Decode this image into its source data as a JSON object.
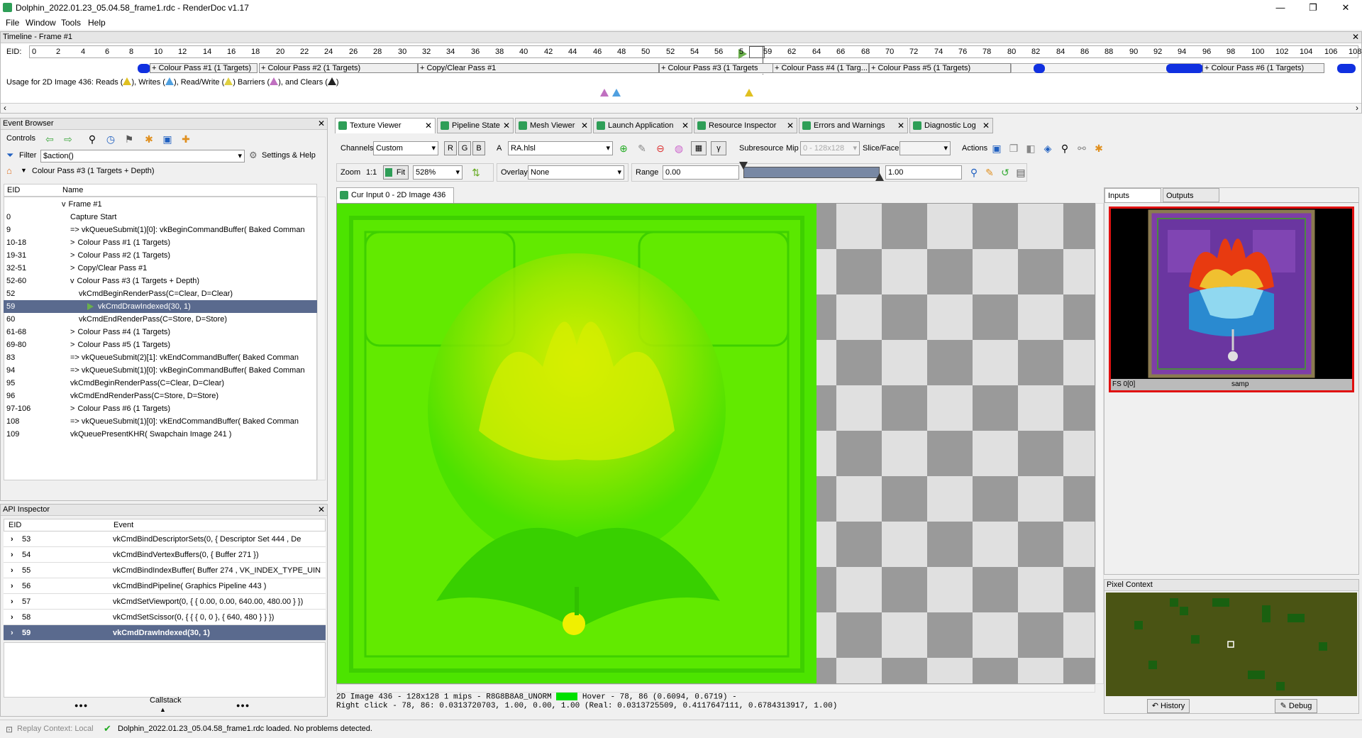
{
  "window": {
    "title": "Dolphin_2022.01.23_05.04.58_frame1.rdc - RenderDoc v1.17",
    "controls": [
      "—",
      "❐",
      "✕"
    ]
  },
  "menu": [
    "File",
    "Window",
    "Tools",
    "Help"
  ],
  "timeline": {
    "title": "Timeline - Frame #1",
    "eid_label": "EID:",
    "ticks": [
      "0",
      "2",
      "4",
      "6",
      "8",
      "10",
      "12",
      "14",
      "16",
      "18",
      "20",
      "22",
      "24",
      "26",
      "28",
      "30",
      "32",
      "34",
      "36",
      "38",
      "40",
      "42",
      "44",
      "46",
      "48",
      "50",
      "52",
      "54",
      "56",
      "5",
      "59",
      "62",
      "64",
      "66",
      "68",
      "70",
      "72",
      "74",
      "76",
      "78",
      "80",
      "82",
      "84",
      "86",
      "88",
      "90",
      "92",
      "94",
      "96",
      "98",
      "100",
      "102",
      "104",
      "106",
      "108"
    ],
    "passes": [
      "+ Colour Pass #1 (1 Targets)",
      "+ Colour Pass #2 (1 Targets)",
      "+ Copy/Clear Pass #1",
      "+ Colour Pass #3 (1 Targets",
      "+ Colour Pass #4 (1 Targ...",
      "+ Colour Pass #5 (1 Targets)",
      "+ Colour Pass #6 (1 Targets)"
    ],
    "usage_text_1": "Usage for 2D Image 436: Reads (",
    "usage_text_2": "), Writes (",
    "usage_text_3": "), Read/Write (",
    "usage_text_4": ") Barriers (",
    "usage_text_5": "), and Clears (",
    "usage_text_6": ")"
  },
  "event_browser": {
    "title": "Event Browser",
    "controls_label": "Controls",
    "filter_label": "Filter",
    "filter_value": "$action()",
    "settings_label": "Settings & Help",
    "breadcrumb": "Colour Pass #3 (1 Targets + Depth)",
    "col_eid": "EID",
    "col_name": "Name",
    "rows": [
      {
        "eid": "",
        "name": "Frame #1",
        "indent": 0,
        "exp": "v"
      },
      {
        "eid": "0",
        "name": "Capture Start",
        "indent": 1,
        "exp": ""
      },
      {
        "eid": "9",
        "name": "=> vkQueueSubmit(1)[0]: vkBeginCommandBuffer( Baked Comman",
        "indent": 1,
        "exp": ""
      },
      {
        "eid": "10-18",
        "name": "Colour Pass #1 (1 Targets)",
        "indent": 1,
        "exp": ">"
      },
      {
        "eid": "19-31",
        "name": "Colour Pass #2 (1 Targets)",
        "indent": 1,
        "exp": ">"
      },
      {
        "eid": "32-51",
        "name": "Copy/Clear Pass #1",
        "indent": 1,
        "exp": ">"
      },
      {
        "eid": "52-60",
        "name": "Colour Pass #3 (1 Targets + Depth)",
        "indent": 1,
        "exp": "v"
      },
      {
        "eid": "52",
        "name": "vkCmdBeginRenderPass(C=Clear, D=Clear)",
        "indent": 2,
        "exp": ""
      },
      {
        "eid": "59",
        "name": "vkCmdDrawIndexed(30, 1)",
        "indent": 3,
        "exp": "",
        "selected": true
      },
      {
        "eid": "60",
        "name": "vkCmdEndRenderPass(C=Store, D=Store)",
        "indent": 2,
        "exp": ""
      },
      {
        "eid": "61-68",
        "name": "Colour Pass #4 (1 Targets)",
        "indent": 1,
        "exp": ">"
      },
      {
        "eid": "69-80",
        "name": "Colour Pass #5 (1 Targets)",
        "indent": 1,
        "exp": ">"
      },
      {
        "eid": "83",
        "name": "=> vkQueueSubmit(2)[1]: vkEndCommandBuffer( Baked Comman",
        "indent": 1,
        "exp": ""
      },
      {
        "eid": "94",
        "name": "=> vkQueueSubmit(1)[0]: vkBeginCommandBuffer( Baked Comman",
        "indent": 1,
        "exp": ""
      },
      {
        "eid": "95",
        "name": "vkCmdBeginRenderPass(C=Clear, D=Clear)",
        "indent": 1,
        "exp": ""
      },
      {
        "eid": "96",
        "name": "vkCmdEndRenderPass(C=Store, D=Store)",
        "indent": 1,
        "exp": ""
      },
      {
        "eid": "97-106",
        "name": "Colour Pass #6 (1 Targets)",
        "indent": 1,
        "exp": ">"
      },
      {
        "eid": "108",
        "name": "=> vkQueueSubmit(1)[0]: vkEndCommandBuffer( Baked Comman",
        "indent": 1,
        "exp": ""
      },
      {
        "eid": "109",
        "name": "vkQueuePresentKHR( Swapchain Image 241 )",
        "indent": 1,
        "exp": ""
      }
    ]
  },
  "api_inspector": {
    "title": "API Inspector",
    "col_eid": "EID",
    "col_event": "Event",
    "rows": [
      {
        "eid": "53",
        "event": "vkCmdBindDescriptorSets(0, { Descriptor Set 444 , De"
      },
      {
        "eid": "54",
        "event": "vkCmdBindVertexBuffers(0, { Buffer 271 })"
      },
      {
        "eid": "55",
        "event": "vkCmdBindIndexBuffer( Buffer 274 , VK_INDEX_TYPE_UIN"
      },
      {
        "eid": "56",
        "event": "vkCmdBindPipeline( Graphics Pipeline 443 )"
      },
      {
        "eid": "57",
        "event": "vkCmdSetViewport(0, { { 0.00, 0.00, 640.00, 480.00 } })"
      },
      {
        "eid": "58",
        "event": "vkCmdSetScissor(0, { { { 0, 0 }, { 640, 480 } } })"
      },
      {
        "eid": "59",
        "event": "vkCmdDrawIndexed(30, 1)",
        "selected": true
      }
    ],
    "callstack_label": "Callstack",
    "dots": "●●●"
  },
  "tabs": [
    {
      "label": "Texture Viewer",
      "active": true
    },
    {
      "label": "Pipeline State"
    },
    {
      "label": "Mesh Viewer"
    },
    {
      "label": "Launch Application"
    },
    {
      "label": "Resource Inspector"
    },
    {
      "label": "Errors and Warnings"
    },
    {
      "label": "Diagnostic Log"
    }
  ],
  "texture_viewer": {
    "channels_label": "Channels",
    "channels_value": "Custom",
    "r": "R",
    "g": "G",
    "b": "B",
    "a": "A",
    "shader_value": "RA.hlsl",
    "gamma": "γ",
    "subresource_label": "Subresource",
    "mip_label": "Mip",
    "mip_value": "0 - 128x128",
    "slice_label": "Slice/Face",
    "actions_label": "Actions",
    "zoom_label": "Zoom",
    "zoom_11": "1:1",
    "fit_label": "Fit",
    "zoom_value": "528%",
    "overlay_label": "Overlay",
    "overlay_value": "None",
    "range_label": "Range",
    "range_min": "0.00",
    "range_max": "1.00",
    "range_min_frac": 0.0,
    "range_max_frac": 1.0,
    "view_tab": "Cur Input 0 - 2D Image 436",
    "status_line1": "2D Image 436 - 128x128 1 mips - R8G8B8A8_UNORM",
    "status_hover": "Hover -    78,   86 (0.6094, 0.6719)  -",
    "status_line2": "Right click -    78,   86: 0.0313720703, 1.00, 0.00, 1.00 (Real: 0.0313725509, 0.4117647111, 0.6784313917, 1.00)"
  },
  "inputs_panel": {
    "tab_inputs": "Inputs",
    "tab_outputs": "Outputs",
    "thumb_label_left": "FS 0[0]",
    "thumb_label_center": "samp"
  },
  "pixel_context": {
    "title": "Pixel Context",
    "history_label": "History",
    "debug_label": "Debug"
  },
  "statusbar": {
    "replay": "Replay Context: Local",
    "message": "Dolphin_2022.01.23_05.04.58_frame1.rdc loaded. No problems detected."
  },
  "colors": {
    "accent_green": "#2e9e57",
    "selection": "#5a6a8e",
    "timeline_blob": "#1030e0",
    "texture_green": "#40e000",
    "red_border": "#e01010"
  }
}
